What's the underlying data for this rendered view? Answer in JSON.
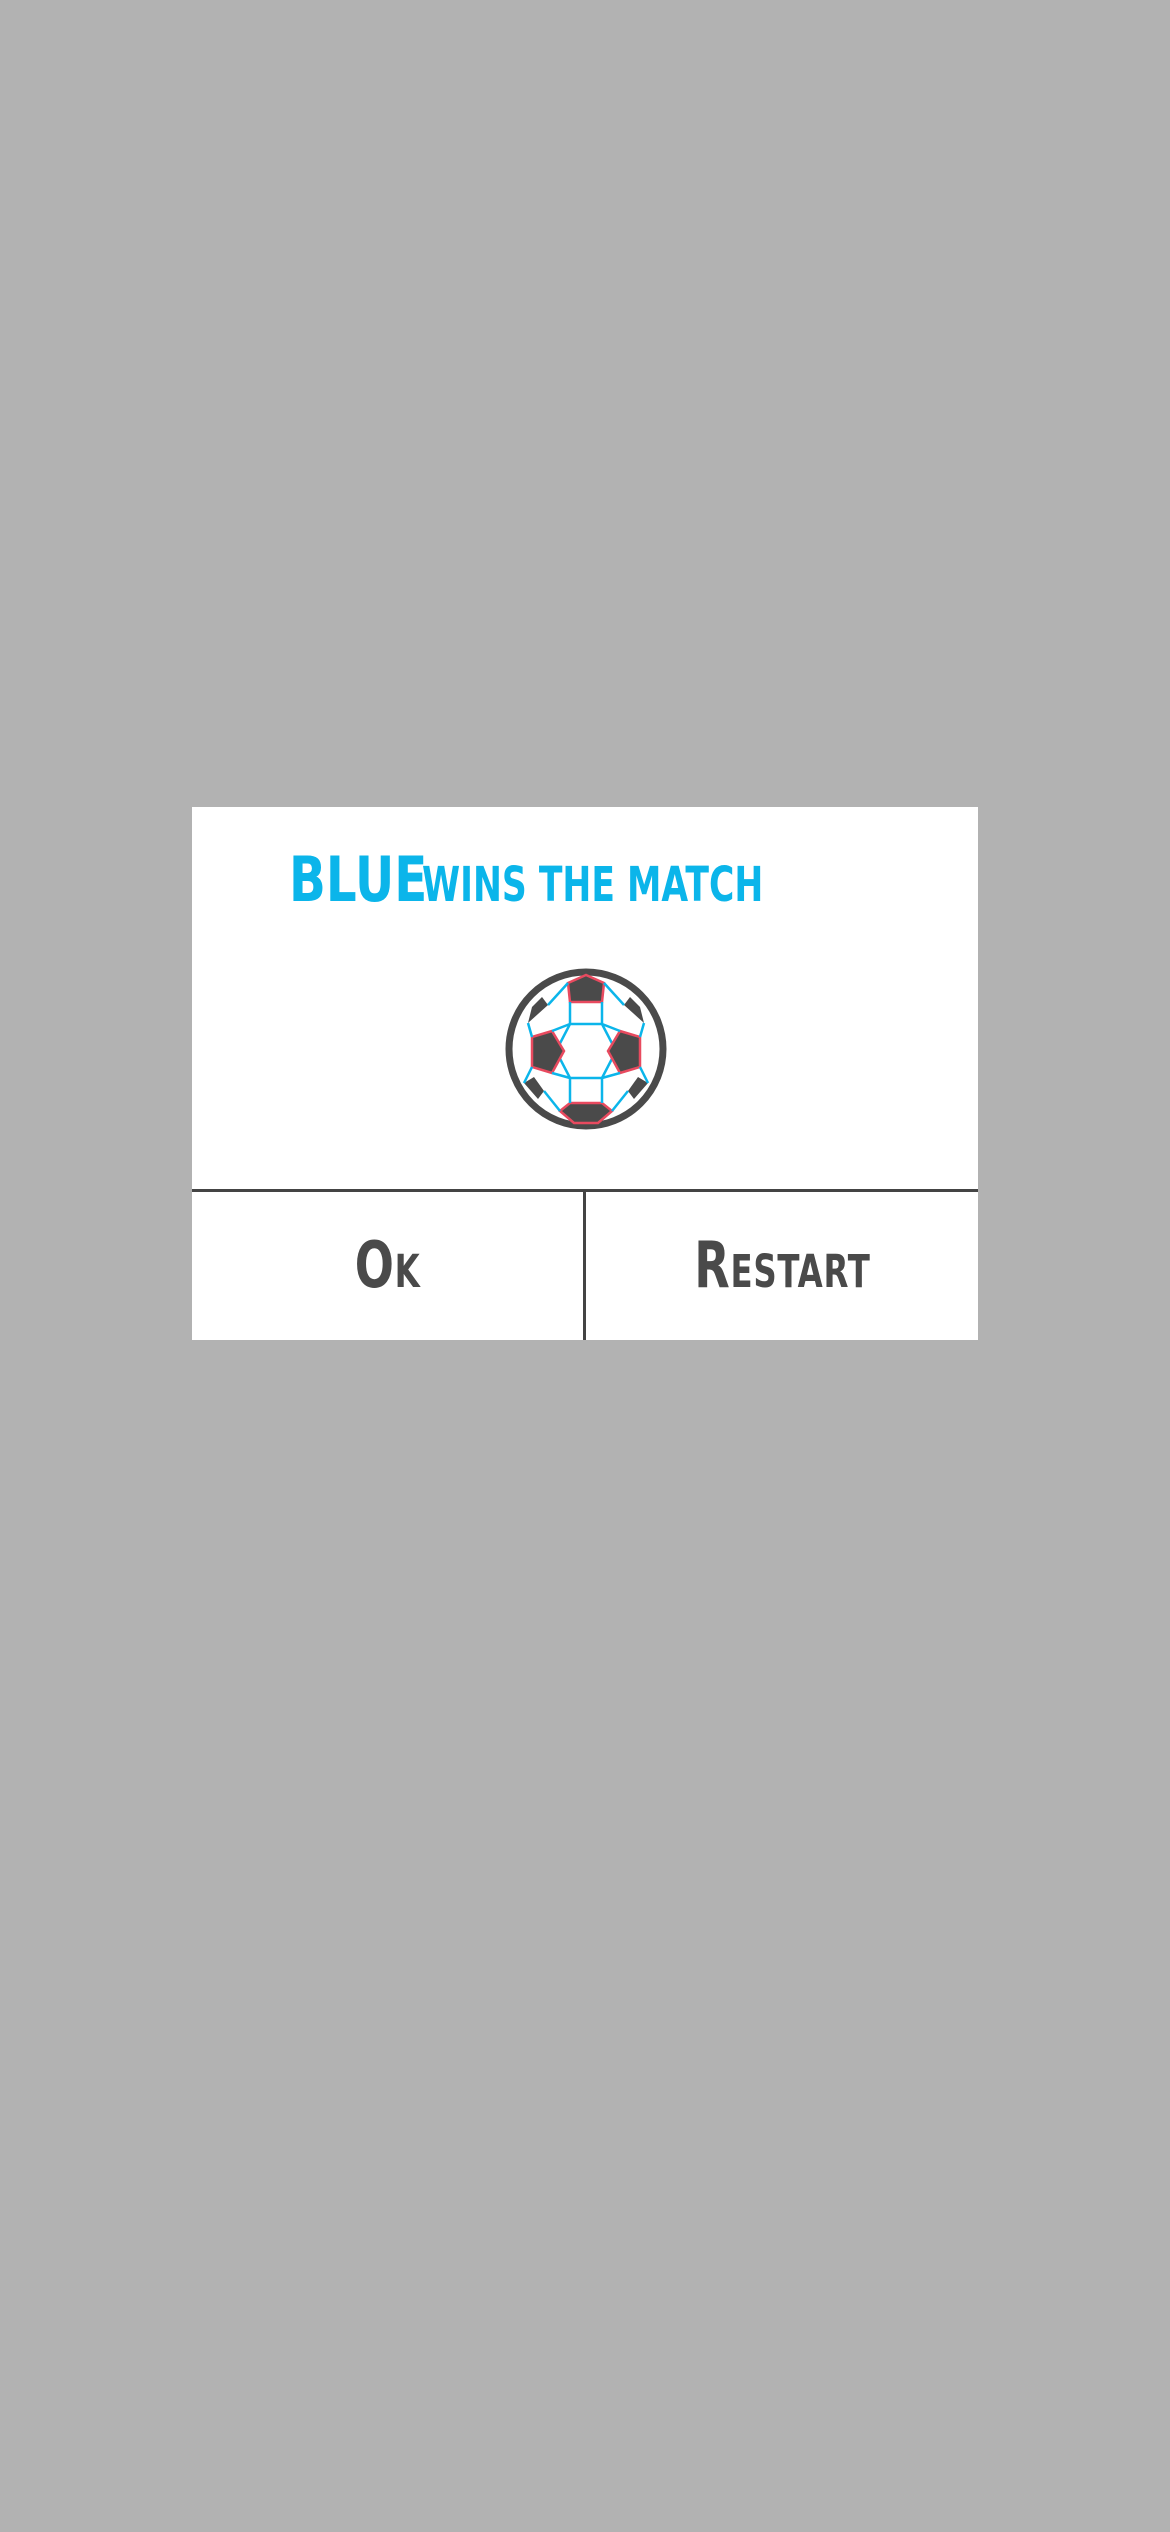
{
  "dialog": {
    "title_winner": "BLUE",
    "title_rest": "wins the match",
    "ball_icon": "soccer-ball-icon",
    "ok_label": "Ok",
    "restart_label": "Restart"
  },
  "colors": {
    "overlay": "#b2b2b2",
    "accent": "#0bb5ea",
    "text_dark": "#4a4a4a",
    "ball_seam_red": "#e84a5f",
    "ball_seam_blue": "#0bb5ea"
  }
}
